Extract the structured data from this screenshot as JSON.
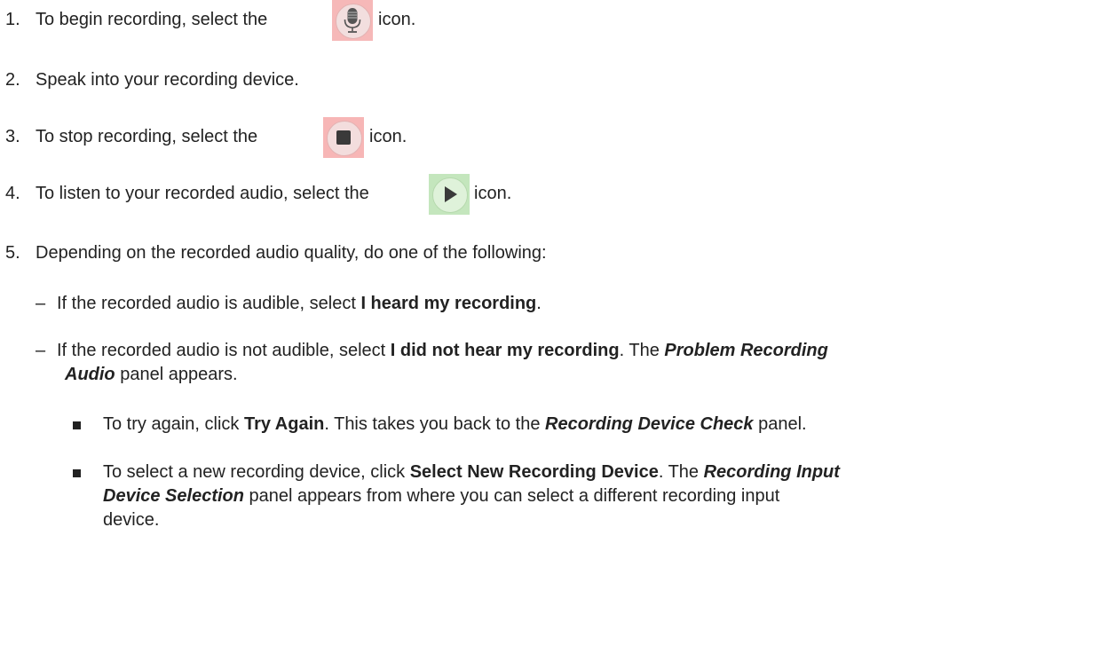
{
  "steps": [
    {
      "num": "1.",
      "pre": "To begin recording, select the",
      "post": "icon."
    },
    {
      "num": "2.",
      "text": "Speak into your recording device."
    },
    {
      "num": "3.",
      "pre": "To stop recording, select the",
      "post": "icon."
    },
    {
      "num": "4.",
      "pre": "To listen to your recorded audio, select the",
      "post": "icon."
    },
    {
      "num": "5.",
      "text": "Depending on the recorded audio quality, do one of the following:"
    }
  ],
  "sub1": {
    "dash": "–",
    "pre": "If the recorded audio is audible, select ",
    "bold": "I heard my recording",
    "post": "."
  },
  "sub2": {
    "dash": "–",
    "pre": "If the recorded audio is not audible, select ",
    "bold": "I did not hear my recording",
    "mid": ". The ",
    "bi1": "Problem Recording",
    "bi2": "Audio",
    "post": " panel appears."
  },
  "bullet1": {
    "pre": "To try again, click ",
    "bold": "Try Again",
    "mid": ". This takes you back to the ",
    "bi": "Recording Device Check",
    "post": " panel."
  },
  "bullet2": {
    "pre": "To select a new recording device, click ",
    "bold": "Select New Recording Device",
    "mid": ". The ",
    "bi1": "Recording Input",
    "bi2": "Device Selection",
    "post1": " panel appears from where you can select a different recording input",
    "post2": "device."
  },
  "icons": {
    "mic": "microphone-icon",
    "stop": "stop-icon",
    "play": "play-icon"
  }
}
